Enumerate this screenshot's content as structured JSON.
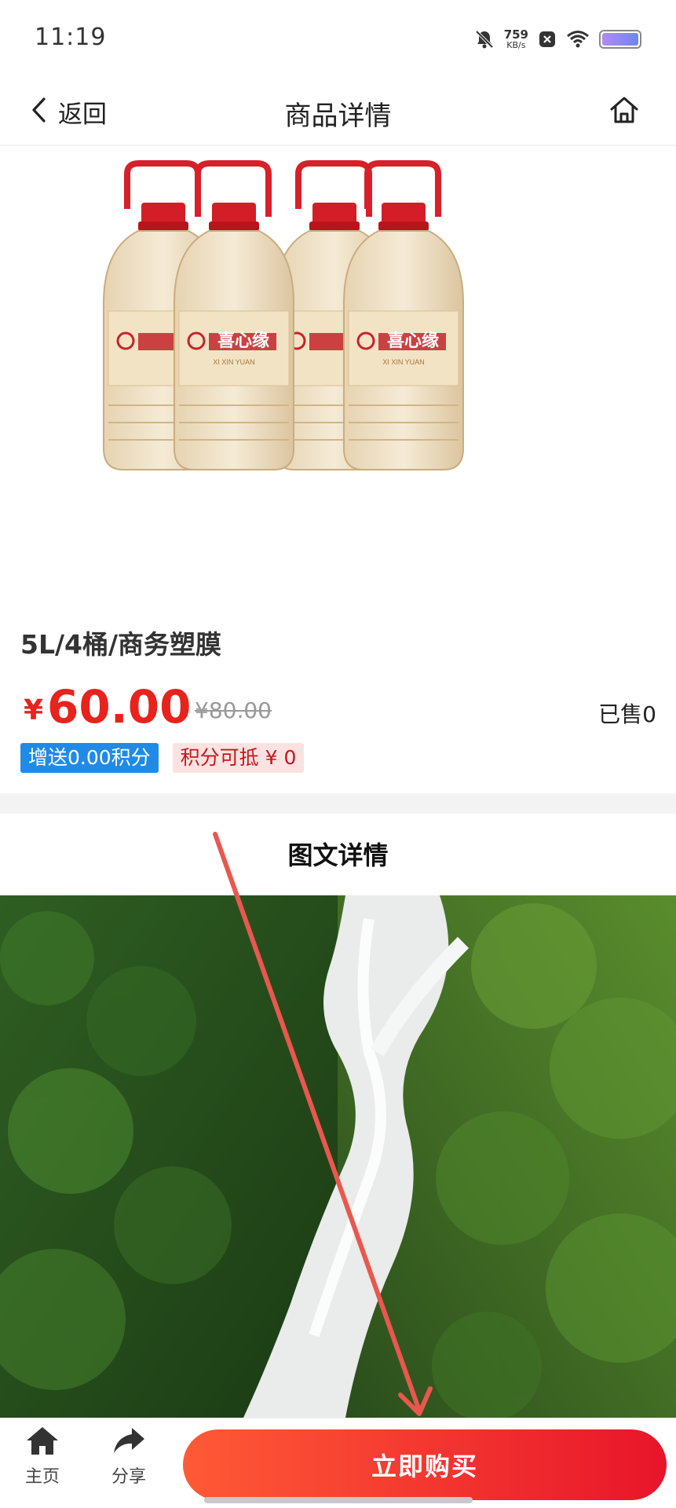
{
  "status_bar": {
    "time": "11:19",
    "net_speed_value": "759",
    "net_speed_unit": "KB/s",
    "icons": [
      "bell-muted-icon",
      "app-notification-icon",
      "wifi-icon",
      "battery-icon"
    ]
  },
  "nav": {
    "back_label": "返回",
    "title": "商品详情",
    "home_icon": "home-icon"
  },
  "product": {
    "brand": "喜心缘",
    "brand_pinyin": "XI XIN YUAN",
    "name": "5L/4桶/商务塑膜",
    "price_symbol": "¥",
    "price": "60.00",
    "original_price": "¥80.00",
    "sold": "已售0",
    "tag_points": "增送0.00积分",
    "tag_deduct": "积分可抵 ¥ 0"
  },
  "detail": {
    "title": "图文详情"
  },
  "bottom_bar": {
    "home_label": "主页",
    "share_label": "分享",
    "buy_label": "立即购买"
  },
  "colors": {
    "price_red": "#e8221c",
    "tag_blue": "#1f8be6",
    "tag_pink_bg": "#fde2e2",
    "buy_gradient_start": "#ff5a36",
    "buy_gradient_end": "#e8152a",
    "annotation_arrow": "#e9574f"
  }
}
